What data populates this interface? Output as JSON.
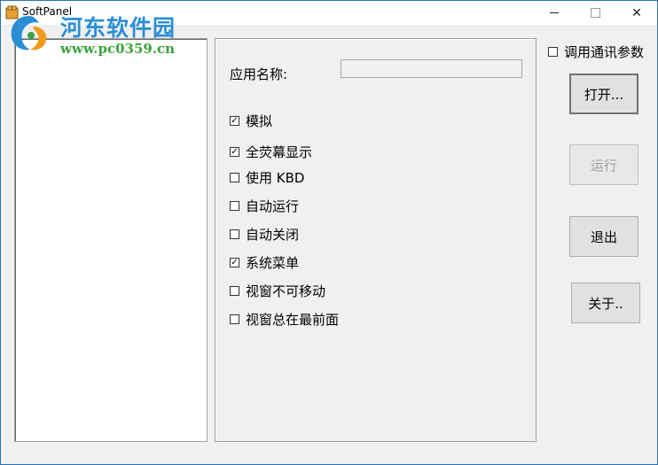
{
  "window": {
    "title": "SoftPanel",
    "controls": {
      "minimize": "",
      "maximize": "",
      "close": "✕"
    }
  },
  "watermark": {
    "name": "河东软件园",
    "url": "www.pc0359.cn"
  },
  "form": {
    "app_name_label": "应用名称:",
    "app_name_value": "",
    "options": [
      {
        "label": "模拟",
        "checked": true
      },
      {
        "label": "全荧幕显示",
        "checked": true
      },
      {
        "label": "使用 KBD",
        "checked": false
      },
      {
        "label": "自动运行",
        "checked": false
      },
      {
        "label": "自动关闭",
        "checked": false
      },
      {
        "label": "系统菜单",
        "checked": true
      },
      {
        "label": "视窗不可移动",
        "checked": false
      },
      {
        "label": "视窗总在最前面",
        "checked": false
      }
    ]
  },
  "right_panel": {
    "comm_params": {
      "label": "调用通讯参数",
      "checked": false
    },
    "buttons": {
      "open": "打开...",
      "run": "运行",
      "exit": "退出",
      "about": "关于.."
    }
  },
  "colors": {
    "window_border": "#2b6fb5",
    "watermark_blue": "#2a8fd6",
    "watermark_green": "#3aa33a"
  }
}
